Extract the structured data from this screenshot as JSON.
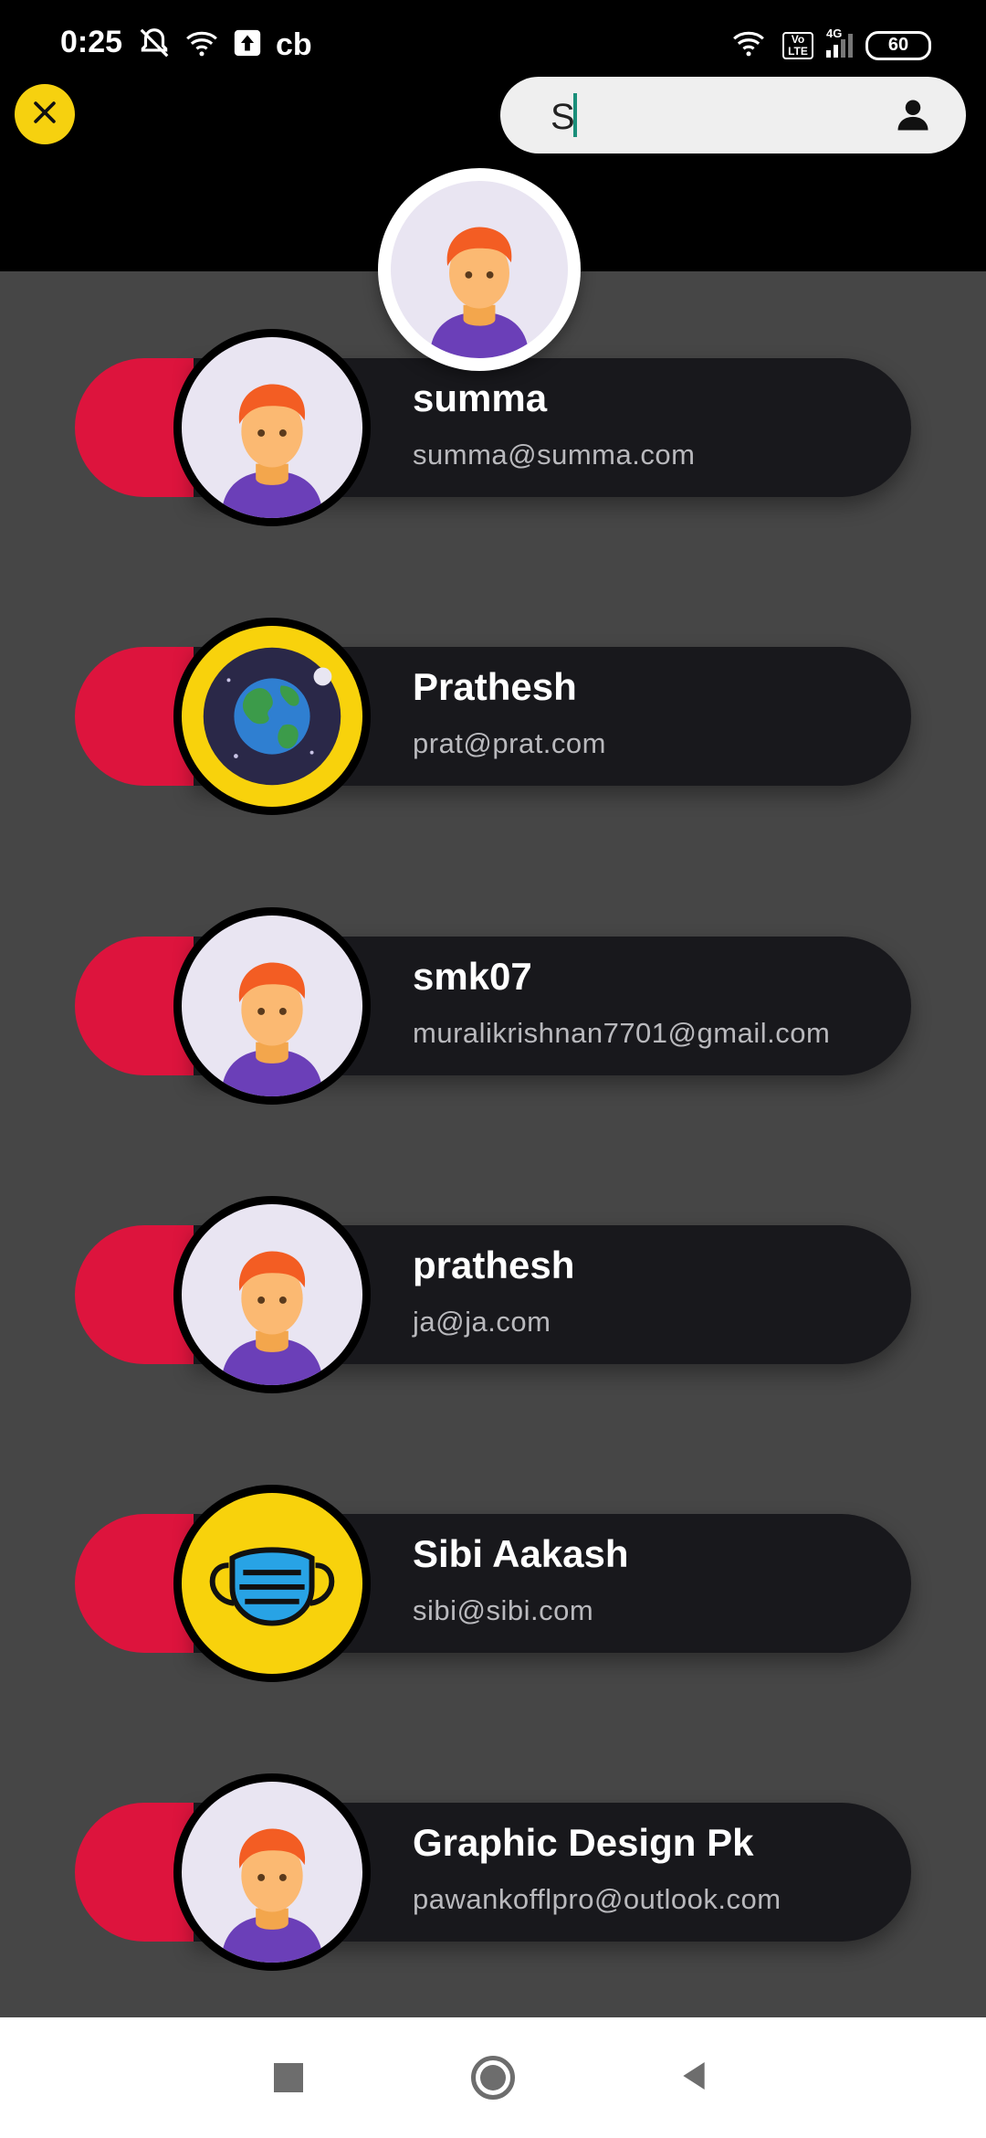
{
  "status_bar": {
    "time": "0:25",
    "carrier_label": "cb",
    "network_label": "4G",
    "volte_label": "Vo LTE",
    "battery": "60"
  },
  "search": {
    "query": "S",
    "close_icon": "close-icon",
    "profile_icon": "person-icon"
  },
  "users": [
    {
      "name": "summa",
      "email": "summa@summa.com",
      "avatar": "person-avatar"
    },
    {
      "name": "Prathesh",
      "email": "prat@prat.com",
      "avatar": "earth-avatar"
    },
    {
      "name": "smk07",
      "email": "muralikrishnan7701@gmail.com",
      "avatar": "person-avatar"
    },
    {
      "name": "prathesh",
      "email": "ja@ja.com",
      "avatar": "person-avatar"
    },
    {
      "name": "Sibi Aakash",
      "email": "sibi@sibi.com",
      "avatar": "mask-avatar"
    },
    {
      "name": "Graphic Design Pk",
      "email": "pawankofflpro@outlook.com",
      "avatar": "person-avatar"
    }
  ],
  "colors": {
    "accent_red": "#dd143d",
    "accent_yellow": "#f6d10f",
    "card_dark": "#18181c",
    "background": "#464646"
  },
  "nav": {
    "recents_icon": "square-icon",
    "home_icon": "circle-home-icon",
    "back_icon": "triangle-back-icon"
  }
}
